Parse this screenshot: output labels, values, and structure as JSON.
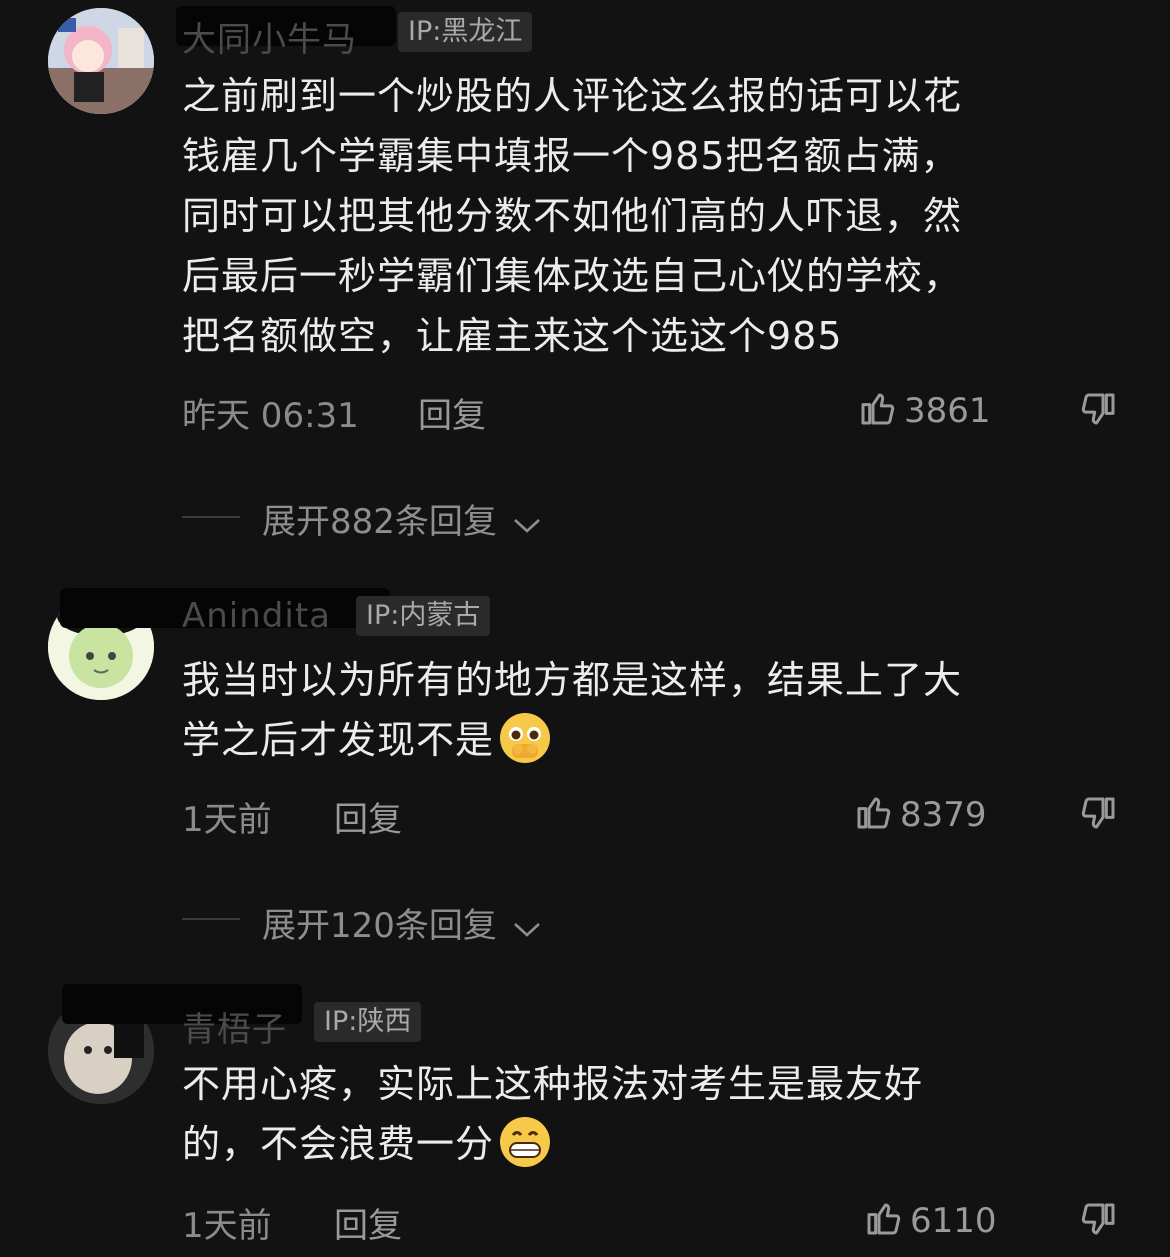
{
  "comments": [
    {
      "username": "大同小牛马",
      "ip": "IP:黑龙江",
      "lines": [
        "之前刷到一个炒股的人评论这么报的话可以花",
        "钱雇几个学霸集中填报一个985把名额占满，",
        "同时可以把其他分数不如他们高的人吓退，然",
        "后最后一秒学霸们集体改选自己心仪的学校，",
        "把名额做空，让雇主来这个选这个985"
      ],
      "time": "昨天 06:31",
      "reply_label": "回复",
      "likes": "3861",
      "expand_label": "展开882条回复",
      "avatar_icon": "anime-girl-avatar"
    },
    {
      "username": "Anindita",
      "ip": "IP:内蒙古",
      "lines": [
        "我当时以为所有的地方都是这样，结果上了大",
        "学之后才发现不是"
      ],
      "emoji": "pleading-face-emoji",
      "time": "1天前",
      "reply_label": "回复",
      "likes": "8379",
      "expand_label": "展开120条回复",
      "avatar_icon": "green-character-avatar"
    },
    {
      "username": "青梧子",
      "ip": "IP:陕西",
      "lines": [
        "不用心疼，实际上这种报法对考生是最友好",
        "的，不会浪费一分"
      ],
      "emoji": "grinning-face-emoji",
      "time": "1天前",
      "reply_label": "回复",
      "likes": "6110",
      "avatar_icon": "plush-toy-avatar"
    }
  ],
  "colors": {
    "background": "#121212",
    "text": "#ececec",
    "muted": "#8b8b8b"
  }
}
